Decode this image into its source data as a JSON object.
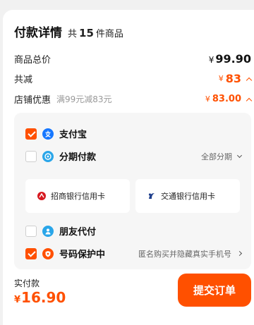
{
  "header": {
    "title": "付款详情",
    "count_prefix": "共",
    "count": "15",
    "count_suffix": "件商品"
  },
  "summary": {
    "total": {
      "label": "商品总价",
      "currency": "¥",
      "amount": "99.90"
    },
    "reduce": {
      "label": "共减",
      "currency": "¥",
      "amount": "83"
    },
    "discount": {
      "label": "店铺优惠",
      "note": "满99元减83元",
      "currency": "¥",
      "amount": "83.00"
    }
  },
  "payment": {
    "alipay": {
      "name": "支付宝",
      "checked": true
    },
    "installment": {
      "name": "分期付款",
      "right_text": "全部分期",
      "checked": false
    },
    "banks": [
      {
        "name": "招商银行信用卡"
      },
      {
        "name": "交通银行信用卡"
      }
    ],
    "friend": {
      "name": "朋友代付",
      "checked": false
    },
    "privacy": {
      "name": "号码保护中",
      "right_text": "匿名购买并隐藏真实手机号",
      "checked": true
    }
  },
  "footer": {
    "label": "实付款",
    "currency": "¥",
    "amount": "16.90",
    "submit_label": "提交订单"
  },
  "colors": {
    "accent": "#ff5000",
    "alipay": "#1677ff",
    "installment": "#2aa6e9",
    "privacy": "#ff5000"
  }
}
